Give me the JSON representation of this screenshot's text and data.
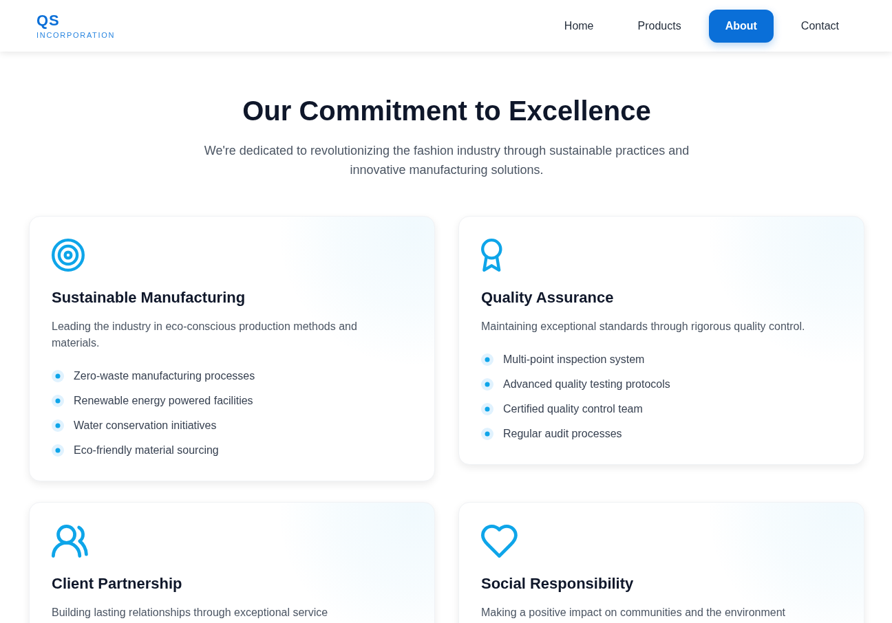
{
  "header": {
    "logo": {
      "mark": "QS",
      "name": "INCORPORATION"
    },
    "nav": [
      {
        "label": "Home",
        "selected": false
      },
      {
        "label": "Products",
        "selected": false
      },
      {
        "label": "About",
        "selected": true
      },
      {
        "label": "Contact",
        "selected": false
      }
    ]
  },
  "intro": {
    "title": "Our Commitment to Excellence",
    "subtitle": "We're dedicated to revolutionizing the fashion industry through sustainable practices and innovative manufacturing solutions."
  },
  "cards": [
    {
      "kind": "target",
      "title": "Sustainable Manufacturing",
      "description": "Leading the industry in eco-conscious production methods and materials.",
      "points": [
        "Zero-waste manufacturing processes",
        "Renewable energy powered facilities",
        "Water conservation initiatives",
        "Eco-friendly material sourcing"
      ]
    },
    {
      "kind": "award",
      "title": "Quality Assurance",
      "description": "Maintaining exceptional standards through rigorous quality control.",
      "points": [
        "Multi-point inspection system",
        "Advanced quality testing protocols",
        "Certified quality control team",
        "Regular audit processes"
      ]
    },
    {
      "kind": "users",
      "title": "Client Partnership",
      "description": "Building lasting relationships through exceptional service"
    },
    {
      "kind": "heart",
      "title": "Social Responsibility",
      "description": "Making a positive impact on communities and the environment"
    }
  ]
}
